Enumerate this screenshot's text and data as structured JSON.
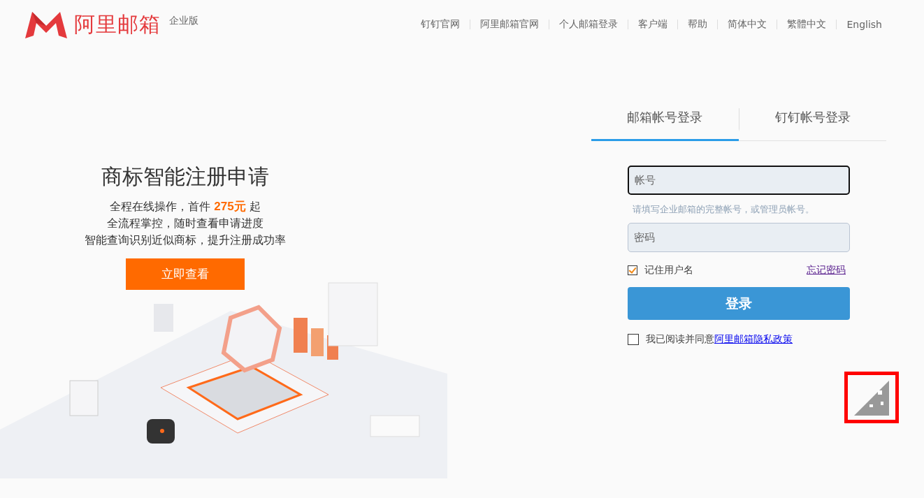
{
  "header": {
    "logo_text": "阿里邮箱",
    "edition": "企业版",
    "nav": [
      "钉钉官网",
      "阿里邮箱官网",
      "个人邮箱登录",
      "客户端",
      "帮助",
      "简体中文",
      "繁體中文",
      "English"
    ]
  },
  "promo": {
    "title": "商标智能注册申请",
    "line1_before": "全程在线操作，首件",
    "price": "275元",
    "line1_after": "起",
    "lines": [
      "全流程掌控，随时查看申请进度",
      "智能查询识别近似商标，提升注册成功率"
    ],
    "button": "立即查看"
  },
  "login": {
    "tabs": [
      {
        "label": "邮箱帐号登录",
        "selected": true
      },
      {
        "label": "钉钉帐号登录",
        "selected": false
      }
    ],
    "account": {
      "placeholder": "帐号",
      "focused": true
    },
    "hint": "请填写企业邮箱的完整帐号，或管理员帐号。",
    "password": {
      "placeholder": "密码"
    },
    "remember": {
      "label": "记住用户名",
      "checked": true
    },
    "forgot": "忘记密码",
    "submit": "登录",
    "agree": {
      "label": "我已阅读并同意",
      "link": "阿里邮箱隐私政策",
      "checked": false
    }
  },
  "qr": {
    "highlighted": true
  }
}
